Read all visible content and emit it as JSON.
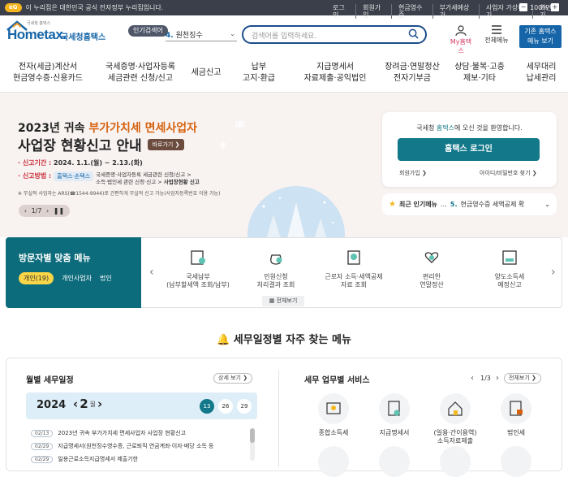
{
  "topbar": {
    "gov_badge": "eG",
    "gov_notice": "이 누리집은 대한민국 공식 전자정부 누리집입니다.",
    "links": [
      "로그인",
      "회원가입",
      "현금영수증",
      "부가세예상가",
      "사업자 가상하기",
      "화면크기"
    ],
    "zoom_value": "100%"
  },
  "header": {
    "logo_small": "국세청 홈택스",
    "logo_text": "Hometax.",
    "logo_kr": "국세청홈택스",
    "popular_badge": "인기검색어",
    "popular_rank": "4.",
    "popular_keyword": "원천징수",
    "search_placeholder": "검색어를 입력하세요.",
    "myhome_label": "My홈택스",
    "allmenu_label": "전체메뉴",
    "basic_btn_line1": "기존 홈택스",
    "basic_btn_line2": "메뉴 보기"
  },
  "gnb": [
    {
      "l1": "전자(세금)계산서",
      "l2": "현금영수증·신용카드"
    },
    {
      "l1": "국세증명·사업자등록",
      "l2": "세금관련 신청/신고"
    },
    {
      "l1": "세금신고",
      "l2": ""
    },
    {
      "l1": "납부",
      "l2": "고지·환급"
    },
    {
      "l1": "지급명세서",
      "l2": "자료제출·공익법인"
    },
    {
      "l1": "장려금·연말정산",
      "l2": "전자기부금"
    },
    {
      "l1": "상담·불복·고충",
      "l2": "제보·기타"
    },
    {
      "l1": "세무대리",
      "l2": "납세관리"
    }
  ],
  "banner": {
    "title1_pre": "2023년 귀속 ",
    "title1_hl": "부가가치세 면세사업자",
    "title2": "사업장 현황신고 안내",
    "go_label": "바로가기",
    "period_label": "· 신고기간 : ",
    "period_value": "2024. 1.1.(월) ~ 2.13.(화)",
    "method_label": "· 신고방법 : ",
    "method_chip": "홈택스·손택스",
    "method_text1": "국세증명·사업자등록 세금관련 신청/신고 >",
    "method_text2": "소득·법인세 관련 신청·신고 > ",
    "method_text3": "사업장현황 신고",
    "note": "※ 무실적 사업자는 ARS(☎1544-9944)로 간편하게 무실적 신고 가능(사업자등록번호 이용 가능)",
    "pager": "1/7"
  },
  "login": {
    "welcome_pre": "국세청 ",
    "welcome_hl": "홈택스",
    "welcome_post": "에 오신 것을 환영합니다.",
    "button": "홈택스 로그인",
    "signup": "회원가입",
    "find": "아이디/비밀번호 찾기"
  },
  "recent": {
    "label": "최근 인기메뉴",
    "dots": "…",
    "rank": "5.",
    "item": "현금영수증 세액공제 확"
  },
  "visitor": {
    "title": "방문자별 맞춤 메뉴",
    "tabs": [
      "개인(19)",
      "개인사업자",
      "법인"
    ],
    "menus": [
      {
        "l1": "국세납부",
        "l2": "(납부할세액 조회/납부)"
      },
      {
        "l1": "민원신청",
        "l2": "처리결과 조회"
      },
      {
        "l1": "근로자 소득·세액공제",
        "l2": "자료 조회"
      },
      {
        "l1": "편리한",
        "l2": "연말정산"
      },
      {
        "l1": "양도소득세",
        "l2": "예정신고"
      }
    ],
    "view_all": "전체보기"
  },
  "section": {
    "title": "세무일정별 자주 찾는 메뉴"
  },
  "schedule": {
    "title": "월별 세무일정",
    "more": "상세 보기",
    "year": "2024",
    "month": "2",
    "month_unit": "월",
    "days": [
      "13",
      "26",
      "29"
    ],
    "items": [
      {
        "date": "02/13",
        "text": "2023년 귀속 부가가치세 면세사업자 사업장 현황신고"
      },
      {
        "date": "02/29",
        "text": "지급명세서(원천징수영수증, 근로퇴직 연금계좌·이자·배당 소득 등"
      },
      {
        "date": "02/29",
        "text": "일용근로소득지급명세서 제출기한"
      }
    ]
  },
  "service": {
    "title": "세무 업무별 서비스",
    "page": "1/3",
    "more": "전체보기",
    "items": [
      {
        "l1": "종합소득세",
        "l2": ""
      },
      {
        "l1": "지급명세서",
        "l2": ""
      },
      {
        "l1": "(일용·간이용역)",
        "l2": "소득자료제출"
      },
      {
        "l1": "법인세",
        "l2": ""
      }
    ]
  },
  "colors": {
    "navy": "#1565a8",
    "teal": "#13788a",
    "orange": "#d6620e",
    "yellow": "#f9d548"
  }
}
